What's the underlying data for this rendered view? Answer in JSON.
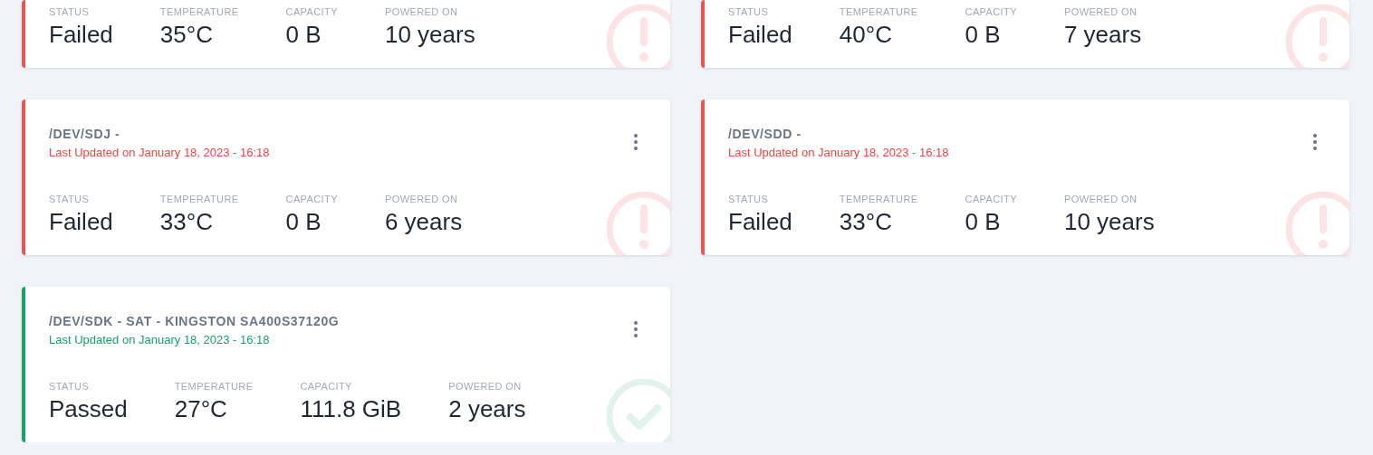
{
  "disks": [
    {
      "kind": "failed",
      "stats": [
        {
          "label": "STATUS",
          "value": "Failed"
        },
        {
          "label": "TEMPERATURE",
          "value": "35°C"
        },
        {
          "label": "CAPACITY",
          "value": "0 B"
        },
        {
          "label": "POWERED ON",
          "value": "10 years"
        }
      ]
    },
    {
      "kind": "failed",
      "stats": [
        {
          "label": "STATUS",
          "value": "Failed"
        },
        {
          "label": "TEMPERATURE",
          "value": "40°C"
        },
        {
          "label": "CAPACITY",
          "value": "0 B"
        },
        {
          "label": "POWERED ON",
          "value": "7 years"
        }
      ]
    },
    {
      "kind": "failed",
      "title": "/DEV/SDJ -",
      "updated": "Last Updated on January 18, 2023 - 16:18",
      "stats": [
        {
          "label": "STATUS",
          "value": "Failed"
        },
        {
          "label": "TEMPERATURE",
          "value": "33°C"
        },
        {
          "label": "CAPACITY",
          "value": "0 B"
        },
        {
          "label": "POWERED ON",
          "value": "6 years"
        }
      ]
    },
    {
      "kind": "failed",
      "title": "/DEV/SDD -",
      "updated": "Last Updated on January 18, 2023 - 16:18",
      "stats": [
        {
          "label": "STATUS",
          "value": "Failed"
        },
        {
          "label": "TEMPERATURE",
          "value": "33°C"
        },
        {
          "label": "CAPACITY",
          "value": "0 B"
        },
        {
          "label": "POWERED ON",
          "value": "10 years"
        }
      ]
    },
    {
      "kind": "passed",
      "title": "/DEV/SDK - SAT - KINGSTON SA400S37120G",
      "updated": "Last Updated on January 18, 2023 - 16:18",
      "stats": [
        {
          "label": "STATUS",
          "value": "Passed"
        },
        {
          "label": "TEMPERATURE",
          "value": "27°C"
        },
        {
          "label": "CAPACITY",
          "value": "111.8 GiB"
        },
        {
          "label": "POWERED ON",
          "value": "2 years"
        }
      ]
    }
  ]
}
